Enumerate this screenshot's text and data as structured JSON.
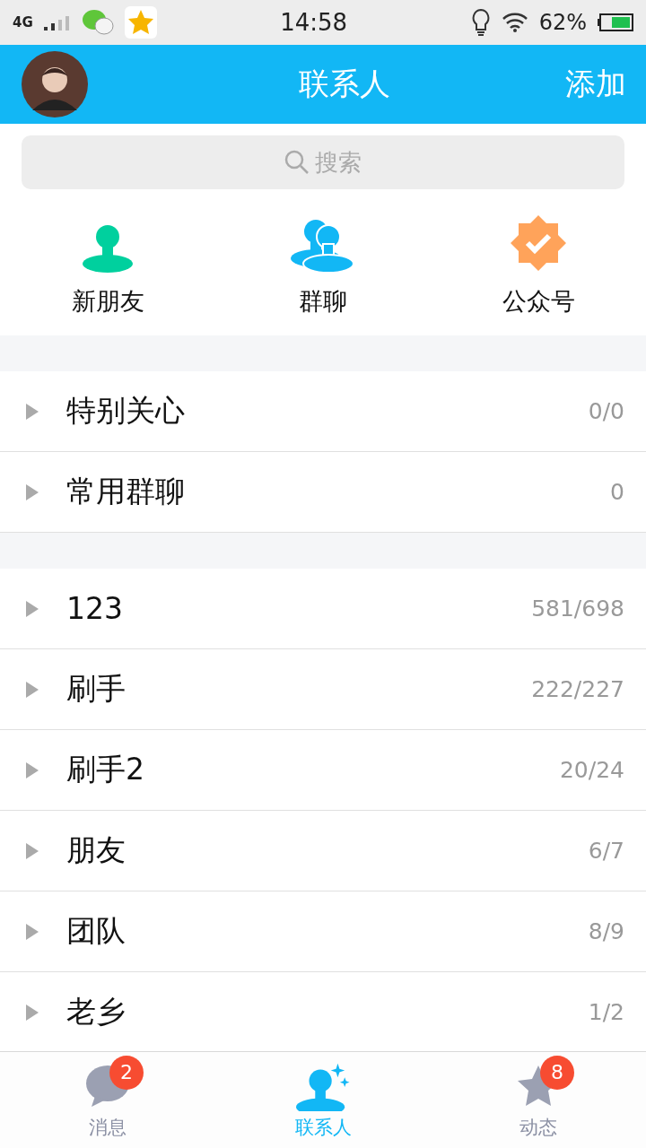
{
  "status_bar": {
    "network": "4G",
    "time": "14:58",
    "battery": "62%"
  },
  "header": {
    "title": "联系人",
    "action": "添加"
  },
  "search": {
    "placeholder": "搜索"
  },
  "shortcuts": [
    {
      "label": "新朋友",
      "kind": "new-friend"
    },
    {
      "label": "群聊",
      "kind": "group"
    },
    {
      "label": "公众号",
      "kind": "official"
    }
  ],
  "sections": [
    [
      {
        "name": "特别关心",
        "count": "0/0",
        "expanded": false
      },
      {
        "name": "常用群聊",
        "count": "0",
        "expanded": false
      }
    ],
    [
      {
        "name": "123",
        "count": "581/698",
        "expanded": false
      },
      {
        "name": "刷手",
        "count": "222/227",
        "expanded": false
      },
      {
        "name": "刷手2",
        "count": "20/24",
        "expanded": false
      },
      {
        "name": "朋友",
        "count": "6/7",
        "expanded": false
      },
      {
        "name": "团队",
        "count": "8/9",
        "expanded": false
      },
      {
        "name": "老乡",
        "count": "1/2",
        "expanded": false
      }
    ]
  ],
  "tabs": [
    {
      "label": "消息",
      "badge": "2",
      "selected": false,
      "kind": "messages"
    },
    {
      "label": "联系人",
      "selected": true,
      "kind": "contacts"
    },
    {
      "label": "动态",
      "badge": "8",
      "selected": false,
      "kind": "feed"
    }
  ]
}
